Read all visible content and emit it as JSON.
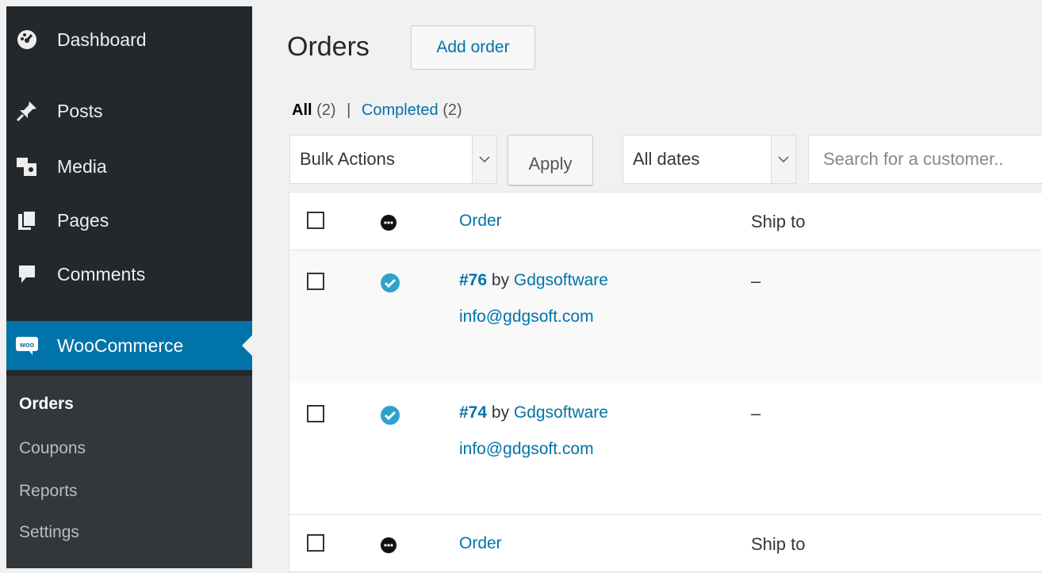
{
  "sidebar": {
    "menu": [
      {
        "label": "Dashboard",
        "icon": "dashboard-icon"
      },
      {
        "label": "Posts",
        "icon": "pin-icon"
      },
      {
        "label": "Media",
        "icon": "media-icon"
      },
      {
        "label": "Pages",
        "icon": "pages-icon"
      },
      {
        "label": "Comments",
        "icon": "comments-icon"
      },
      {
        "label": "WooCommerce",
        "icon": "woo-icon",
        "icon_text": "woo"
      }
    ],
    "submenu": [
      "Orders",
      "Coupons",
      "Reports",
      "Settings"
    ],
    "active_color": "#0073aa"
  },
  "page": {
    "title": "Orders",
    "add_button": "Add order"
  },
  "filters": {
    "all_label": "All",
    "all_count": "(2)",
    "separator": "|",
    "completed_label": "Completed",
    "completed_count": "(2)"
  },
  "toolbar": {
    "bulk_actions": "Bulk Actions",
    "apply": "Apply",
    "dates": "All dates",
    "search_placeholder": "Search for a customer.."
  },
  "table": {
    "columns": {
      "order": "Order",
      "ship_to": "Ship to"
    },
    "rows": [
      {
        "number": "#76",
        "by": "by",
        "customer": "Gdgsoftware",
        "email": "info@gdgsoft.com",
        "ship_to": "–",
        "status": "completed"
      },
      {
        "number": "#74",
        "by": "by",
        "customer": "Gdgsoftware",
        "email": "info@gdgsoft.com",
        "ship_to": "–",
        "status": "completed"
      }
    ],
    "status_color": "#2ea2cc"
  }
}
